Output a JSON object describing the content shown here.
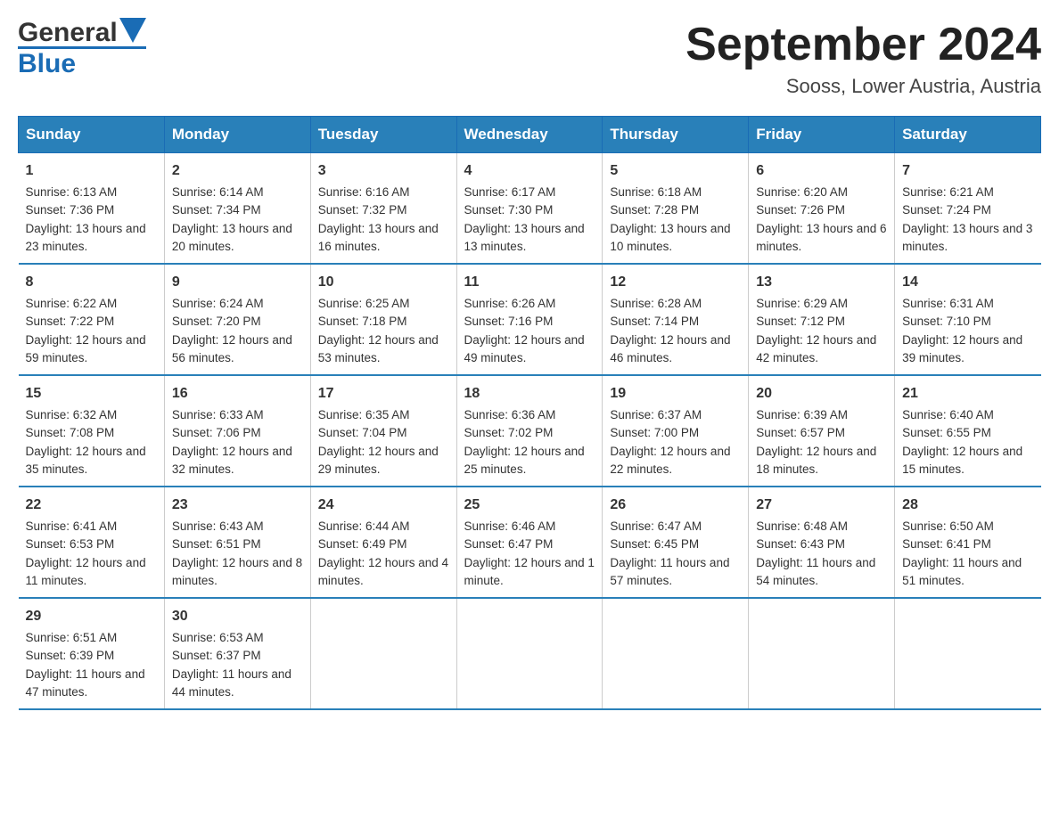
{
  "header": {
    "title": "September 2024",
    "subtitle": "Sooss, Lower Austria, Austria",
    "logo_general": "General",
    "logo_blue": "Blue"
  },
  "weekdays": [
    "Sunday",
    "Monday",
    "Tuesday",
    "Wednesday",
    "Thursday",
    "Friday",
    "Saturday"
  ],
  "weeks": [
    [
      {
        "num": "1",
        "sunrise": "6:13 AM",
        "sunset": "7:36 PM",
        "daylight": "13 hours and 23 minutes."
      },
      {
        "num": "2",
        "sunrise": "6:14 AM",
        "sunset": "7:34 PM",
        "daylight": "13 hours and 20 minutes."
      },
      {
        "num": "3",
        "sunrise": "6:16 AM",
        "sunset": "7:32 PM",
        "daylight": "13 hours and 16 minutes."
      },
      {
        "num": "4",
        "sunrise": "6:17 AM",
        "sunset": "7:30 PM",
        "daylight": "13 hours and 13 minutes."
      },
      {
        "num": "5",
        "sunrise": "6:18 AM",
        "sunset": "7:28 PM",
        "daylight": "13 hours and 10 minutes."
      },
      {
        "num": "6",
        "sunrise": "6:20 AM",
        "sunset": "7:26 PM",
        "daylight": "13 hours and 6 minutes."
      },
      {
        "num": "7",
        "sunrise": "6:21 AM",
        "sunset": "7:24 PM",
        "daylight": "13 hours and 3 minutes."
      }
    ],
    [
      {
        "num": "8",
        "sunrise": "6:22 AM",
        "sunset": "7:22 PM",
        "daylight": "12 hours and 59 minutes."
      },
      {
        "num": "9",
        "sunrise": "6:24 AM",
        "sunset": "7:20 PM",
        "daylight": "12 hours and 56 minutes."
      },
      {
        "num": "10",
        "sunrise": "6:25 AM",
        "sunset": "7:18 PM",
        "daylight": "12 hours and 53 minutes."
      },
      {
        "num": "11",
        "sunrise": "6:26 AM",
        "sunset": "7:16 PM",
        "daylight": "12 hours and 49 minutes."
      },
      {
        "num": "12",
        "sunrise": "6:28 AM",
        "sunset": "7:14 PM",
        "daylight": "12 hours and 46 minutes."
      },
      {
        "num": "13",
        "sunrise": "6:29 AM",
        "sunset": "7:12 PM",
        "daylight": "12 hours and 42 minutes."
      },
      {
        "num": "14",
        "sunrise": "6:31 AM",
        "sunset": "7:10 PM",
        "daylight": "12 hours and 39 minutes."
      }
    ],
    [
      {
        "num": "15",
        "sunrise": "6:32 AM",
        "sunset": "7:08 PM",
        "daylight": "12 hours and 35 minutes."
      },
      {
        "num": "16",
        "sunrise": "6:33 AM",
        "sunset": "7:06 PM",
        "daylight": "12 hours and 32 minutes."
      },
      {
        "num": "17",
        "sunrise": "6:35 AM",
        "sunset": "7:04 PM",
        "daylight": "12 hours and 29 minutes."
      },
      {
        "num": "18",
        "sunrise": "6:36 AM",
        "sunset": "7:02 PM",
        "daylight": "12 hours and 25 minutes."
      },
      {
        "num": "19",
        "sunrise": "6:37 AM",
        "sunset": "7:00 PM",
        "daylight": "12 hours and 22 minutes."
      },
      {
        "num": "20",
        "sunrise": "6:39 AM",
        "sunset": "6:57 PM",
        "daylight": "12 hours and 18 minutes."
      },
      {
        "num": "21",
        "sunrise": "6:40 AM",
        "sunset": "6:55 PM",
        "daylight": "12 hours and 15 minutes."
      }
    ],
    [
      {
        "num": "22",
        "sunrise": "6:41 AM",
        "sunset": "6:53 PM",
        "daylight": "12 hours and 11 minutes."
      },
      {
        "num": "23",
        "sunrise": "6:43 AM",
        "sunset": "6:51 PM",
        "daylight": "12 hours and 8 minutes."
      },
      {
        "num": "24",
        "sunrise": "6:44 AM",
        "sunset": "6:49 PM",
        "daylight": "12 hours and 4 minutes."
      },
      {
        "num": "25",
        "sunrise": "6:46 AM",
        "sunset": "6:47 PM",
        "daylight": "12 hours and 1 minute."
      },
      {
        "num": "26",
        "sunrise": "6:47 AM",
        "sunset": "6:45 PM",
        "daylight": "11 hours and 57 minutes."
      },
      {
        "num": "27",
        "sunrise": "6:48 AM",
        "sunset": "6:43 PM",
        "daylight": "11 hours and 54 minutes."
      },
      {
        "num": "28",
        "sunrise": "6:50 AM",
        "sunset": "6:41 PM",
        "daylight": "11 hours and 51 minutes."
      }
    ],
    [
      {
        "num": "29",
        "sunrise": "6:51 AM",
        "sunset": "6:39 PM",
        "daylight": "11 hours and 47 minutes."
      },
      {
        "num": "30",
        "sunrise": "6:53 AM",
        "sunset": "6:37 PM",
        "daylight": "11 hours and 44 minutes."
      },
      {
        "num": "",
        "sunrise": "",
        "sunset": "",
        "daylight": ""
      },
      {
        "num": "",
        "sunrise": "",
        "sunset": "",
        "daylight": ""
      },
      {
        "num": "",
        "sunrise": "",
        "sunset": "",
        "daylight": ""
      },
      {
        "num": "",
        "sunrise": "",
        "sunset": "",
        "daylight": ""
      },
      {
        "num": "",
        "sunrise": "",
        "sunset": "",
        "daylight": ""
      }
    ]
  ]
}
